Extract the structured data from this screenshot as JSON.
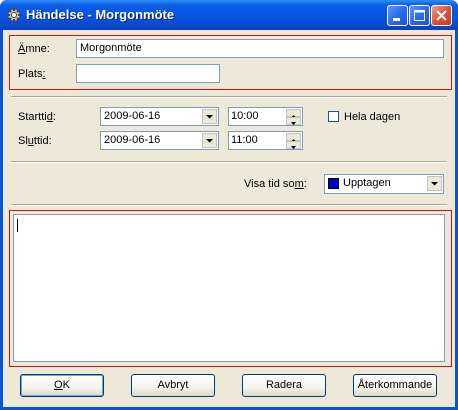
{
  "window": {
    "title": "Händelse - Morgonmöte"
  },
  "subject": {
    "label": "Ämne:",
    "value": "Morgonmöte"
  },
  "location": {
    "label": "Plats:",
    "value": ""
  },
  "start": {
    "label": "Starttid:",
    "date": "2009-06-16",
    "time": "10:00"
  },
  "end": {
    "label": "Sluttid:",
    "date": "2009-06-16",
    "time": "11:00"
  },
  "all_day": {
    "label": "Hela dagen",
    "checked": false
  },
  "show_time_as": {
    "label": "Visa tid som:",
    "value": "Upptagen",
    "color": "#0000cc"
  },
  "notes": {
    "value": ""
  },
  "buttons": {
    "ok": "OK",
    "cancel": "Avbryt",
    "delete": "Radera",
    "recurrence": "Återkommande"
  },
  "colors": {
    "highlight_border": "#e01010",
    "dialog_bg": "#ece9d8",
    "title_blue": "#0554e2"
  }
}
